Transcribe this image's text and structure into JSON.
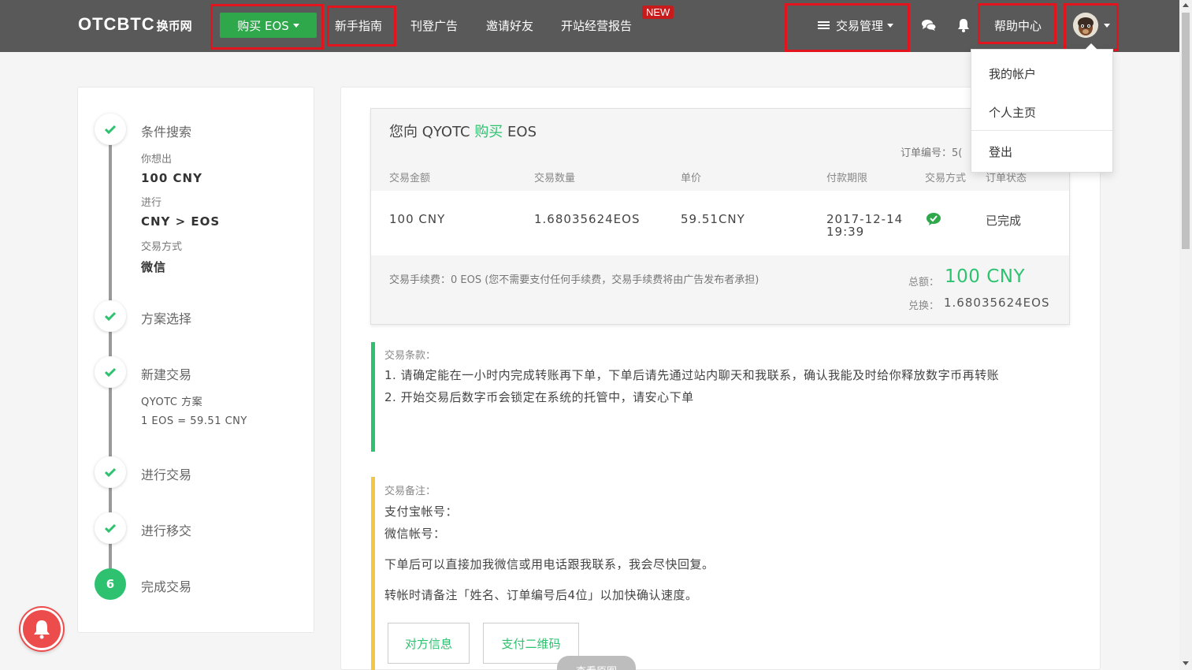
{
  "navbar": {
    "logo": "OTCBTC",
    "logo_sub": "换币网",
    "buy_button": "购买 EOS",
    "links": [
      "新手指南",
      "刊登广告",
      "邀请好友",
      "开站经营报告"
    ],
    "new_badge": "NEW",
    "trade_management": "交易管理",
    "help_center": "帮助中心"
  },
  "user_menu": {
    "items": [
      "我的帐户",
      "个人主页",
      "登出"
    ]
  },
  "sidebar": {
    "step1": {
      "title": "条件搜索",
      "want_label": "你想出",
      "want_value": "100 CNY",
      "do_label": "进行",
      "do_value": "CNY > EOS",
      "method_label": "交易方式",
      "method_value": "微信"
    },
    "step2": {
      "title": "方案选择"
    },
    "step3": {
      "title": "新建交易",
      "plan": "QYOTC 方案",
      "rate": "1 EOS = 59.51 CNY"
    },
    "step4": {
      "title": "进行交易"
    },
    "step5": {
      "title": "进行移交"
    },
    "step6": {
      "number": "6",
      "title": "完成交易"
    }
  },
  "order": {
    "title_prefix": "您向 QYOTC",
    "title_action": "购买",
    "title_coin": "EOS",
    "order_no_label": "订单编号：5(",
    "headers": [
      "交易金额",
      "交易数量",
      "单价",
      "付款期限",
      "交易方式",
      "订单状态"
    ],
    "row": {
      "amount": "100 CNY",
      "quantity": "1.68035624EOS",
      "price": "59.51CNY",
      "deadline": "2017-12-14 19:39",
      "method_icon": "wechat-icon",
      "status": "已完成"
    },
    "fee_text": "交易手续费：0 EOS (您不需要支付任何手续费，交易手续费将由广告发布者承担)",
    "total_label": "总额：",
    "total_value": "100 CNY",
    "exchange_label": "兑换：",
    "exchange_value": "1.68035624EOS"
  },
  "terms": {
    "heading": "交易条款：",
    "line1": "1. 请确定能在一小时内完成转账再下单，下单后请先通过站内聊天和我联系，确认我能及时给你释放数字币再转账",
    "line2": "2. 开始交易后数字币会锁定在系统的托管中，请安心下单"
  },
  "notes": {
    "heading": "交易备注：",
    "alipay": "支付宝帐号：",
    "wechat": "微信帐号：",
    "contact": "下单后可以直接加我微信或用电话跟我联系，我会尽快回复。",
    "remark": "转帐时请备注「姓名、订单编号后4位」以加快确认速度。"
  },
  "buttons": {
    "counterparty": "对方信息",
    "pay_qr": "支付二维码",
    "view_original": "查看原图"
  },
  "colors": {
    "navbar": "#595959",
    "accent_green": "#2ec270",
    "buy_green": "#2ea84b",
    "highlight_red": "#e2141d",
    "notes_yellow": "#f2c744"
  }
}
